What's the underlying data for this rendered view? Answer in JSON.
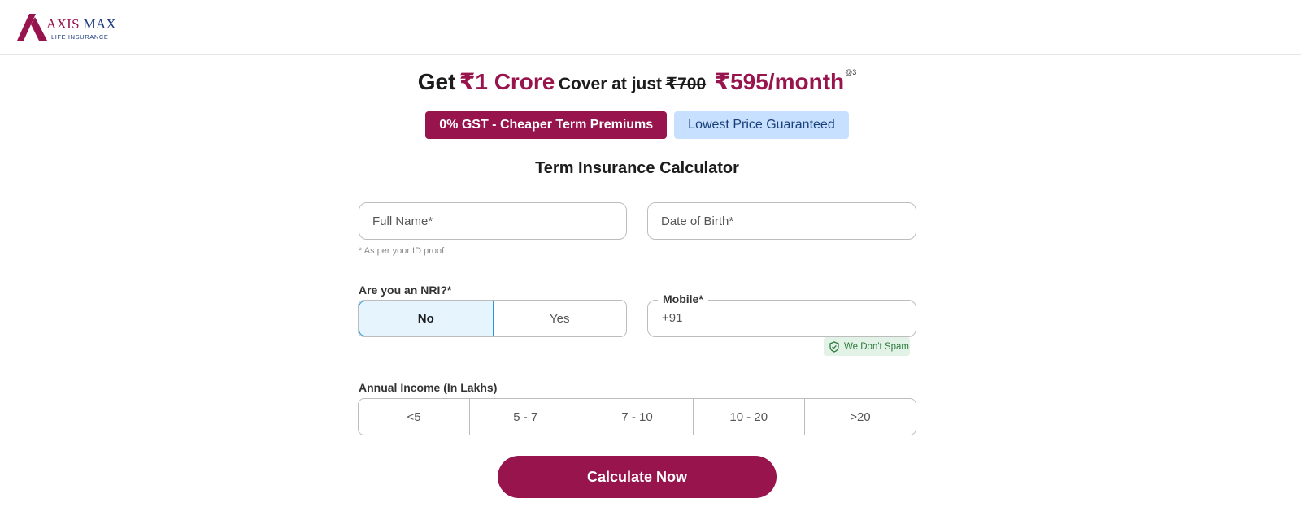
{
  "brand": {
    "name_part1": "AXIS",
    "name_part2": "MAX",
    "tagline": "LIFE INSURANCE",
    "color_primary": "#97144d",
    "color_secondary": "#1e3a7b"
  },
  "headline": {
    "get": "Get",
    "amount": "₹1 Crore",
    "cover_text": "Cover at just",
    "old_price": "₹700",
    "new_price": "₹595/month",
    "superscript": "@3"
  },
  "badges": {
    "gst": "0% GST - Cheaper Term Premiums",
    "lowest_price": "Lowest Price Guaranteed"
  },
  "form": {
    "title": "Term Insurance Calculator",
    "full_name_placeholder": "Full Name*",
    "dob_placeholder": "Date of Birth*",
    "name_hint": "* As per your ID proof",
    "nri_label": "Are you an NRI?*",
    "nri_options": [
      "No",
      "Yes"
    ],
    "nri_selected": "No",
    "mobile_label": "Mobile*",
    "mobile_code": "+91",
    "no_spam": "We Don't Spam",
    "income_label": "Annual Income (In Lakhs)",
    "income_options": [
      "<5",
      "5 - 7",
      "7 - 10",
      "10 - 20",
      ">20"
    ],
    "submit_label": "Calculate Now"
  }
}
